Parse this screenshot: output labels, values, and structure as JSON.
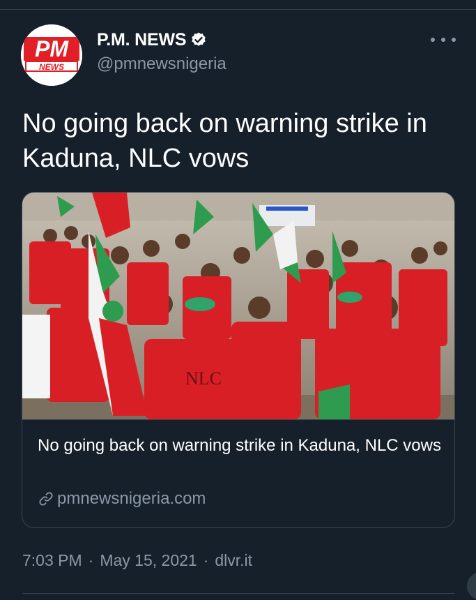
{
  "author": {
    "display_name": "P.M. NEWS",
    "handle": "@pmnewsnigeria",
    "verified": true,
    "avatar_logo_text_top": "PM",
    "avatar_logo_text_bottom": "NEWS"
  },
  "tweet": {
    "text": "No going back on warning strike in Kaduna, NLC vows"
  },
  "card": {
    "title": "No going back on warning strike in Kaduna, NLC vows",
    "domain": "pmnewsnigeria.com",
    "image_description": "NLC members in red vests marching with green-white-red flags"
  },
  "meta": {
    "time": "7:03 PM",
    "separator": "·",
    "date": "May 15, 2021",
    "source": "dlvr.it"
  },
  "icons": {
    "verified": "verified-badge-icon",
    "more": "more-options-icon",
    "link": "link-icon"
  },
  "colors": {
    "background": "#15202b",
    "secondary_text": "#8b98a5",
    "border": "#38444d",
    "brand_red": "#e21f26"
  }
}
